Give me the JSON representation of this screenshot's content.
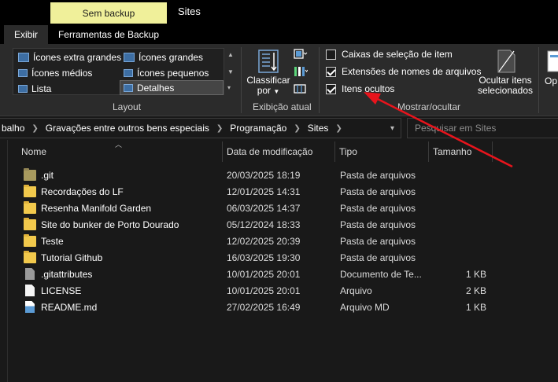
{
  "titlebar": {
    "context_tab": "Sem backup",
    "title": "Sites"
  },
  "tabs": [
    {
      "label": "Exibir",
      "active": true
    },
    {
      "label": "Ferramentas de Backup",
      "active": false
    }
  ],
  "ribbon": {
    "layout": {
      "items": [
        {
          "label": "Ícones extra grandes"
        },
        {
          "label": "Ícones grandes"
        },
        {
          "label": "Ícones médios"
        },
        {
          "label": "Ícones pequenos"
        },
        {
          "label": "Lista"
        },
        {
          "label": "Detalhes",
          "selected": true
        }
      ],
      "group_label": "Layout"
    },
    "current_view": {
      "sort_button_line1": "Classificar",
      "sort_button_line2": "por",
      "group_label": "Exibição atual"
    },
    "show_hide": {
      "checkboxes": [
        {
          "label": "Caixas de seleção de item",
          "checked": false
        },
        {
          "label": "Extensões de nomes de arquivos",
          "checked": true
        },
        {
          "label": "Itens ocultos",
          "checked": true
        }
      ],
      "hide_selected_line1": "Ocultar itens",
      "hide_selected_line2": "selecionados",
      "group_label": "Mostrar/ocultar"
    },
    "options_label": "Op"
  },
  "address": {
    "crumbs": [
      "balho",
      "Gravações entre outros bens especiais",
      "Programação",
      "Sites"
    ],
    "search_placeholder": "Pesquisar em Sites"
  },
  "columns": {
    "name": "Nome",
    "modified": "Data de modificação",
    "type": "Tipo",
    "size": "Tamanho"
  },
  "files": [
    {
      "name": ".git",
      "modified": "20/03/2025 18:19",
      "type": "Pasta de arquivos",
      "size": "",
      "icon": "folder-hidden"
    },
    {
      "name": "Recordações do LF",
      "modified": "12/01/2025 14:31",
      "type": "Pasta de arquivos",
      "size": "",
      "icon": "folder"
    },
    {
      "name": "Resenha Manifold Garden",
      "modified": "06/03/2025 14:37",
      "type": "Pasta de arquivos",
      "size": "",
      "icon": "folder"
    },
    {
      "name": "Site do bunker de Porto Dourado",
      "modified": "05/12/2024 18:33",
      "type": "Pasta de arquivos",
      "size": "",
      "icon": "folder"
    },
    {
      "name": "Teste",
      "modified": "12/02/2025 20:39",
      "type": "Pasta de arquivos",
      "size": "",
      "icon": "folder"
    },
    {
      "name": "Tutorial Github",
      "modified": "16/03/2025 19:30",
      "type": "Pasta de arquivos",
      "size": "",
      "icon": "folder"
    },
    {
      "name": ".gitattributes",
      "modified": "10/01/2025 20:01",
      "type": "Documento de Te...",
      "size": "1 KB",
      "icon": "doc-hidden"
    },
    {
      "name": "LICENSE",
      "modified": "10/01/2025 20:01",
      "type": "Arquivo",
      "size": "2 KB",
      "icon": "doc"
    },
    {
      "name": "README.md",
      "modified": "27/02/2025 16:49",
      "type": "Arquivo MD",
      "size": "1 KB",
      "icon": "doc-md"
    }
  ],
  "colors": {
    "context_tab_bg": "#f0f09a",
    "ribbon_bg": "#2b2b2b",
    "list_bg": "#191919",
    "folder": "#f2c94c",
    "annotation_arrow": "#e8141c"
  }
}
